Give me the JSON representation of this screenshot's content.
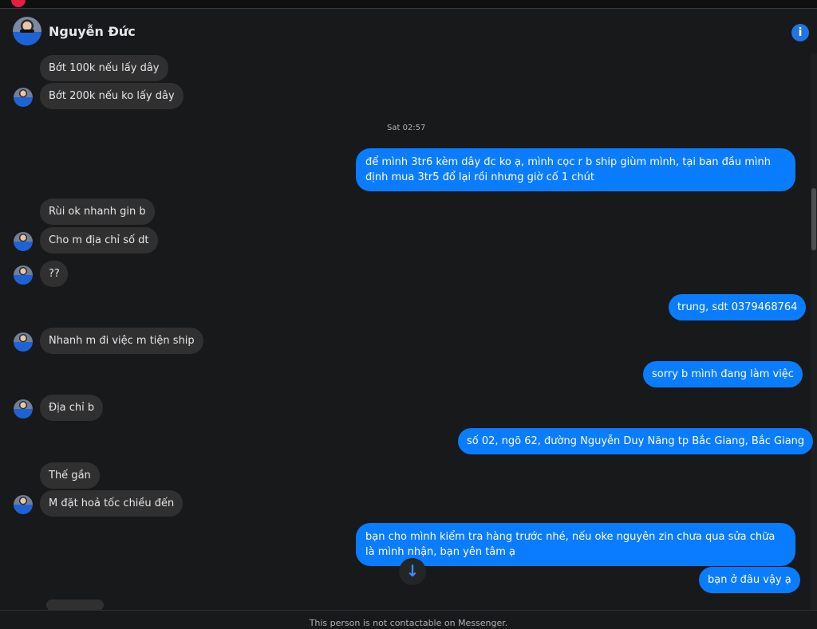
{
  "header": {
    "contact_name": "Nguyễn Đức",
    "info_icon": "info-icon",
    "info_glyph": "i"
  },
  "conversation": {
    "timestamp": "Sat 02:57",
    "messages": [
      {
        "from": "them",
        "text": "Bớt 100k nếu lấy dây"
      },
      {
        "from": "them",
        "text": "Bớt 200k nếu ko lấy dây"
      },
      {
        "from": "me",
        "text": "để mình 3tr6 kèm dây đc ko ạ, mình cọc r b ship giùm mình, tại ban đầu mình định mua 3tr5 đổ lại rồi nhưng giờ cố 1 chút"
      },
      {
        "from": "them",
        "text": "Rùi ok nhanh gin b"
      },
      {
        "from": "them",
        "text": "Cho m địa chỉ số dt"
      },
      {
        "from": "them",
        "text": "??"
      },
      {
        "from": "me",
        "text": "trung, sdt 0379468764"
      },
      {
        "from": "them",
        "text": "Nhanh m đi việc m tiện ship"
      },
      {
        "from": "me",
        "text": "sorry b mình đang làm việc"
      },
      {
        "from": "them",
        "text": "Địa chỉ b"
      },
      {
        "from": "me",
        "text": "số 02, ngõ 62, đường Nguyễn Duy Năng tp Bắc Giang, Bắc Giang"
      },
      {
        "from": "them",
        "text": "Thế gần"
      },
      {
        "from": "them",
        "text": "M đặt hoả tốc chiều đến"
      },
      {
        "from": "me",
        "text": "bạn cho mình kiểm tra hàng trước nhé, nếu oke nguyên zin chưa qua sửa chữa là mình nhận, bạn yên tâm ạ"
      },
      {
        "from": "me",
        "text": "bạn ở đâu vậy ạ"
      }
    ]
  },
  "scroll_down_icon": "arrow-down-icon",
  "scroll_down_glyph": "↓",
  "footer": {
    "notice": "This person is not contactable on Messenger."
  },
  "colors": {
    "background": "#18191a",
    "incoming_bubble": "#303030",
    "outgoing_bubble": "#0a7cff",
    "accent": "#2374e1"
  }
}
